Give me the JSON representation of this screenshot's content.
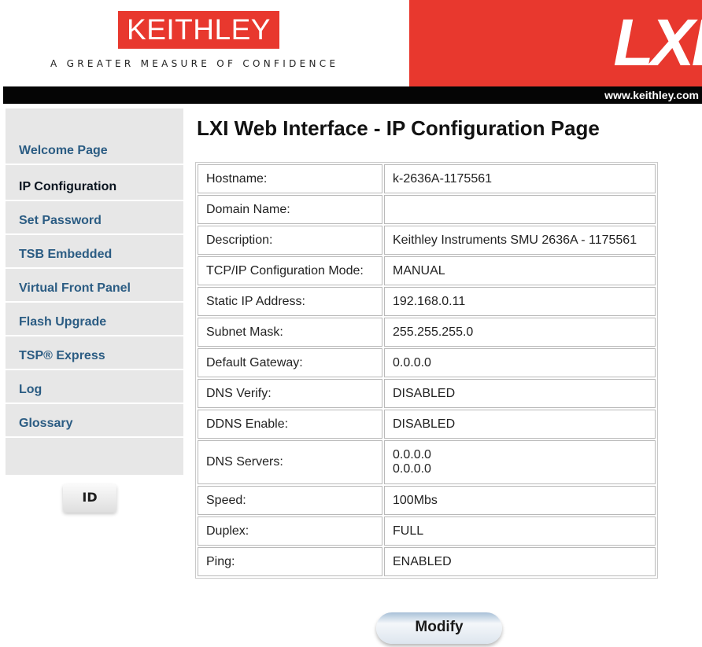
{
  "header": {
    "logo": "KEITHLEY",
    "tagline": "A GREATER MEASURE OF CONFIDENCE",
    "lxi_logo": "LXI",
    "url": "www.keithley.com",
    "brand_color": "#e8382e"
  },
  "sidebar": {
    "items": [
      {
        "label": "Welcome Page",
        "active": false
      },
      {
        "label": "IP Configuration",
        "active": true
      },
      {
        "label": "Set Password",
        "active": false
      },
      {
        "label": "TSB Embedded",
        "active": false
      },
      {
        "label": "Virtual Front Panel",
        "active": false
      },
      {
        "label": "Flash Upgrade",
        "active": false
      },
      {
        "label": "TSP® Express",
        "active": false
      },
      {
        "label": "Log",
        "active": false
      },
      {
        "label": "Glossary",
        "active": false
      }
    ],
    "id_button": "ID",
    "link_color": "#2b5c83"
  },
  "main": {
    "title": "LXI Web Interface - IP Configuration Page",
    "rows": [
      {
        "label": "Hostname:",
        "value": "k-2636A-1175561"
      },
      {
        "label": "Domain Name:",
        "value": ""
      },
      {
        "label": "Description:",
        "value": "Keithley Instruments SMU 2636A - 1175561"
      },
      {
        "label": "TCP/IP Configuration Mode:",
        "value": "MANUAL"
      },
      {
        "label": "Static IP Address:",
        "value": "192.168.0.11"
      },
      {
        "label": "Subnet Mask:",
        "value": "255.255.255.0"
      },
      {
        "label": "Default Gateway:",
        "value": "0.0.0.0"
      },
      {
        "label": "DNS Verify:",
        "value": "DISABLED"
      },
      {
        "label": "DDNS Enable:",
        "value": "DISABLED"
      },
      {
        "label": "DNS Servers:",
        "value": "0.0.0.0",
        "value2": "0.0.0.0"
      },
      {
        "label": "Speed:",
        "value": "100Mbs"
      },
      {
        "label": "Duplex:",
        "value": "FULL"
      },
      {
        "label": "Ping:",
        "value": "ENABLED"
      }
    ],
    "modify_button": "Modify"
  }
}
